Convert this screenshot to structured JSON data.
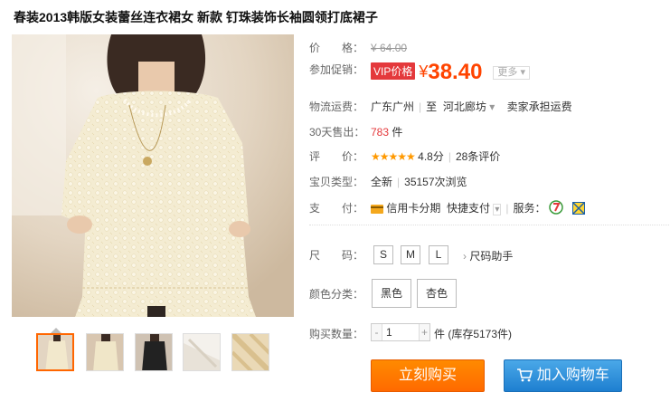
{
  "title": "春装2013韩版女装蕾丝连衣裙女 新款 钉珠装饰长袖圆领打底裙子",
  "price": {
    "label": "价　　格：",
    "original": "¥ 64.00"
  },
  "promo": {
    "label": "参加促销：",
    "badge": "VIP价格",
    "currency": "¥",
    "value": "38.40",
    "more_label": "更多"
  },
  "shipping": {
    "label": "物流运费：",
    "from": "广东广州",
    "to_prefix": "至",
    "to": "河北廊坊",
    "fee": "卖家承担运费"
  },
  "sales": {
    "label": "30天售出：",
    "count": "783",
    "unit": "件"
  },
  "rating": {
    "label": "评　　价：",
    "stars": "★★★★★",
    "score": "4.8分",
    "reviews": "28条评价"
  },
  "item_type": {
    "label": "宝贝类型：",
    "condition": "全新",
    "views": "35157次浏览"
  },
  "payment": {
    "label": "支　　付：",
    "credit": "信用卡分期",
    "quick": "快捷支付",
    "service_label": "服务："
  },
  "sizes": {
    "label": "尺　　码：",
    "options": [
      "S",
      "M",
      "L"
    ],
    "helper": "尺码助手"
  },
  "colors": {
    "label": "颜色分类：",
    "options": [
      "黑色",
      "杏色"
    ]
  },
  "quantity": {
    "label": "购买数量：",
    "value": "1",
    "minus": "-",
    "plus": "+",
    "stock": "件 (库存5173件)"
  },
  "actions": {
    "buy_now": "立刻购买",
    "add_to_cart": "加入购物车"
  },
  "colors_theme": {
    "accent": "#ff4400",
    "badge": "#e4393c",
    "buy": "#ff7a00",
    "cart": "#2a8ad8"
  }
}
